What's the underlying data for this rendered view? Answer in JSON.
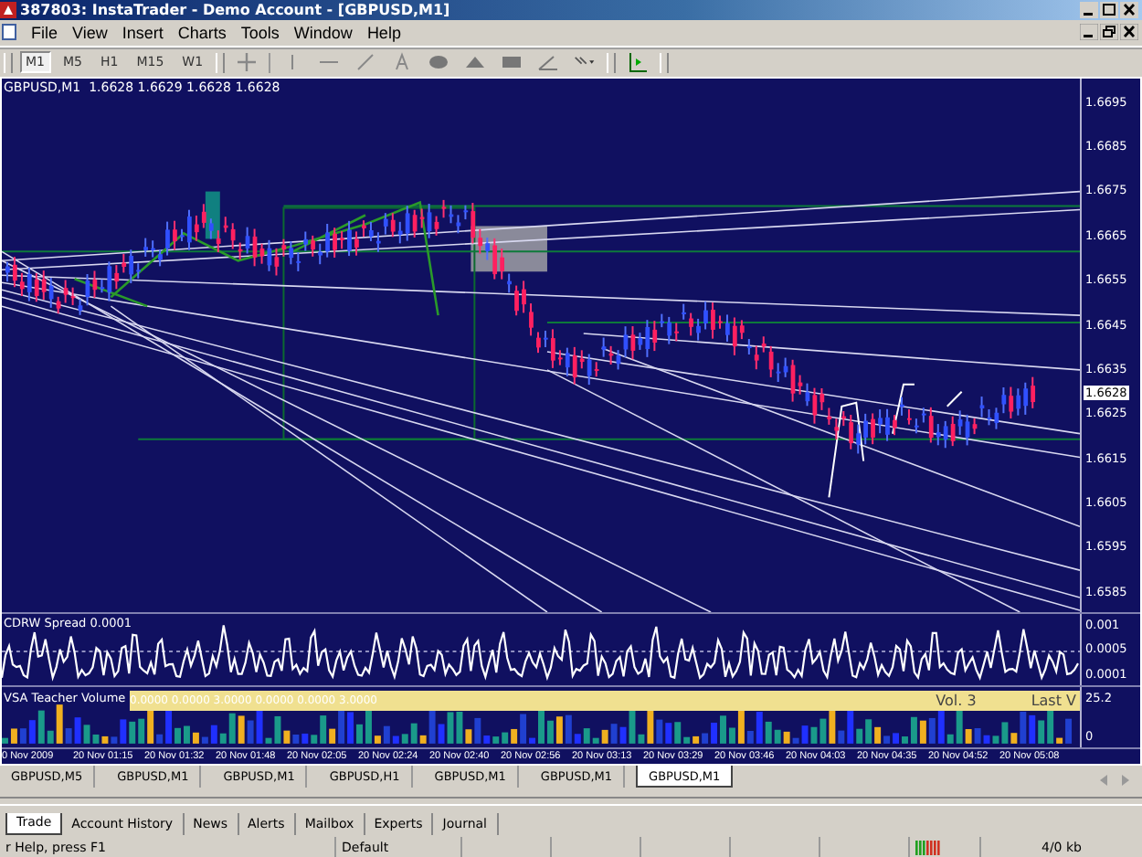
{
  "window": {
    "title": "387803: InstaTrader - Demo Account - [GBPUSD,M1]"
  },
  "menu": [
    "File",
    "View",
    "Insert",
    "Charts",
    "Tools",
    "Window",
    "Help"
  ],
  "periods": [
    {
      "label": "M1",
      "selected": true
    },
    {
      "label": "M5",
      "selected": false
    },
    {
      "label": "H1",
      "selected": false
    },
    {
      "label": "M15",
      "selected": false
    },
    {
      "label": "W1",
      "selected": false
    }
  ],
  "chart": {
    "symbol_info": "GBPUSD,M1  1.6628 1.6629 1.6628 1.6628",
    "price_axis": [
      "1.6695",
      "1.6685",
      "1.6675",
      "1.6665",
      "1.6655",
      "1.6645",
      "1.6635",
      "1.6625",
      "1.6615",
      "1.6605",
      "1.6595",
      "1.6585"
    ],
    "current_price": "1.6628"
  },
  "spread_indicator": {
    "label": "CDRW Spread 0.0001",
    "axis": [
      "0.001",
      "0.0005",
      "0.0001"
    ]
  },
  "volume_indicator": {
    "label": "VSA Teacher Volume",
    "values": "0.0000 0.0000 3.0000 0.0000 0.0000 3.0000",
    "vol": "Vol.  3",
    "last": "Last V",
    "axis": [
      "25.2",
      "0"
    ]
  },
  "time_axis": [
    "0 Nov 2009",
    "20 Nov 01:15",
    "20 Nov 01:32",
    "20 Nov 01:48",
    "20 Nov 02:05",
    "20 Nov 02:24",
    "20 Nov 02:40",
    "20 Nov 02:56",
    "20 Nov 03:13",
    "20 Nov 03:29",
    "20 Nov 03:46",
    "20 Nov 04:03",
    "20 Nov 04:35",
    "20 Nov 04:52",
    "20 Nov 05:08"
  ],
  "chart_tabs": [
    {
      "label": "GBPUSD,M5",
      "selected": false
    },
    {
      "label": "GBPUSD,M1",
      "selected": false
    },
    {
      "label": "GBPUSD,M1",
      "selected": false
    },
    {
      "label": "GBPUSD,H1",
      "selected": false
    },
    {
      "label": "GBPUSD,M1",
      "selected": false
    },
    {
      "label": "GBPUSD,M1",
      "selected": false
    },
    {
      "label": "GBPUSD,M1",
      "selected": true
    }
  ],
  "terminal_tabs": [
    {
      "label": "Trade",
      "selected": true
    },
    {
      "label": "Account History",
      "selected": false
    },
    {
      "label": "News",
      "selected": false
    },
    {
      "label": "Alerts",
      "selected": false
    },
    {
      "label": "Mailbox",
      "selected": false
    },
    {
      "label": "Experts",
      "selected": false
    },
    {
      "label": "Journal",
      "selected": false
    }
  ],
  "status_bar": {
    "help": "r Help, press F1",
    "profile": "Default",
    "traffic": "4/0 kb"
  }
}
